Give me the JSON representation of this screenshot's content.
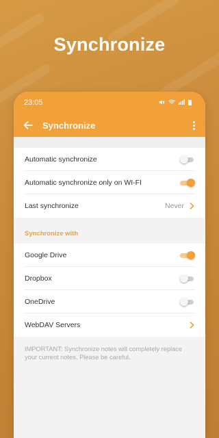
{
  "hero": {
    "title": "Synchronize"
  },
  "status_bar": {
    "time": "23:05"
  },
  "app_bar": {
    "title": "Synchronize"
  },
  "general": {
    "items": [
      {
        "label": "Automatic synchronize",
        "type": "toggle",
        "on": false
      },
      {
        "label": "Automatic synchronize only on WI-FI",
        "type": "toggle",
        "on": true
      },
      {
        "label": "Last synchronize",
        "type": "link",
        "value": "Never"
      }
    ]
  },
  "sync_with": {
    "header": "Synchronize with",
    "items": [
      {
        "label": "Google Drive",
        "type": "toggle",
        "on": true
      },
      {
        "label": "Dropbox",
        "type": "toggle",
        "on": false
      },
      {
        "label": "OneDrive",
        "type": "toggle",
        "on": false
      },
      {
        "label": "WebDAV Servers",
        "type": "link"
      }
    ]
  },
  "note": "IMPORTANT: Synchronize notes will completely replace your current notes, Please be careful.",
  "colors": {
    "accent": "#f2a039",
    "background": "#c98a3a"
  },
  "icons": {
    "back": "arrow-left-icon",
    "more": "more-vertical-icon",
    "chevron": "chevron-right-icon",
    "status": [
      "mute-icon",
      "wifi-icon",
      "signal-icon",
      "battery-icon"
    ]
  }
}
